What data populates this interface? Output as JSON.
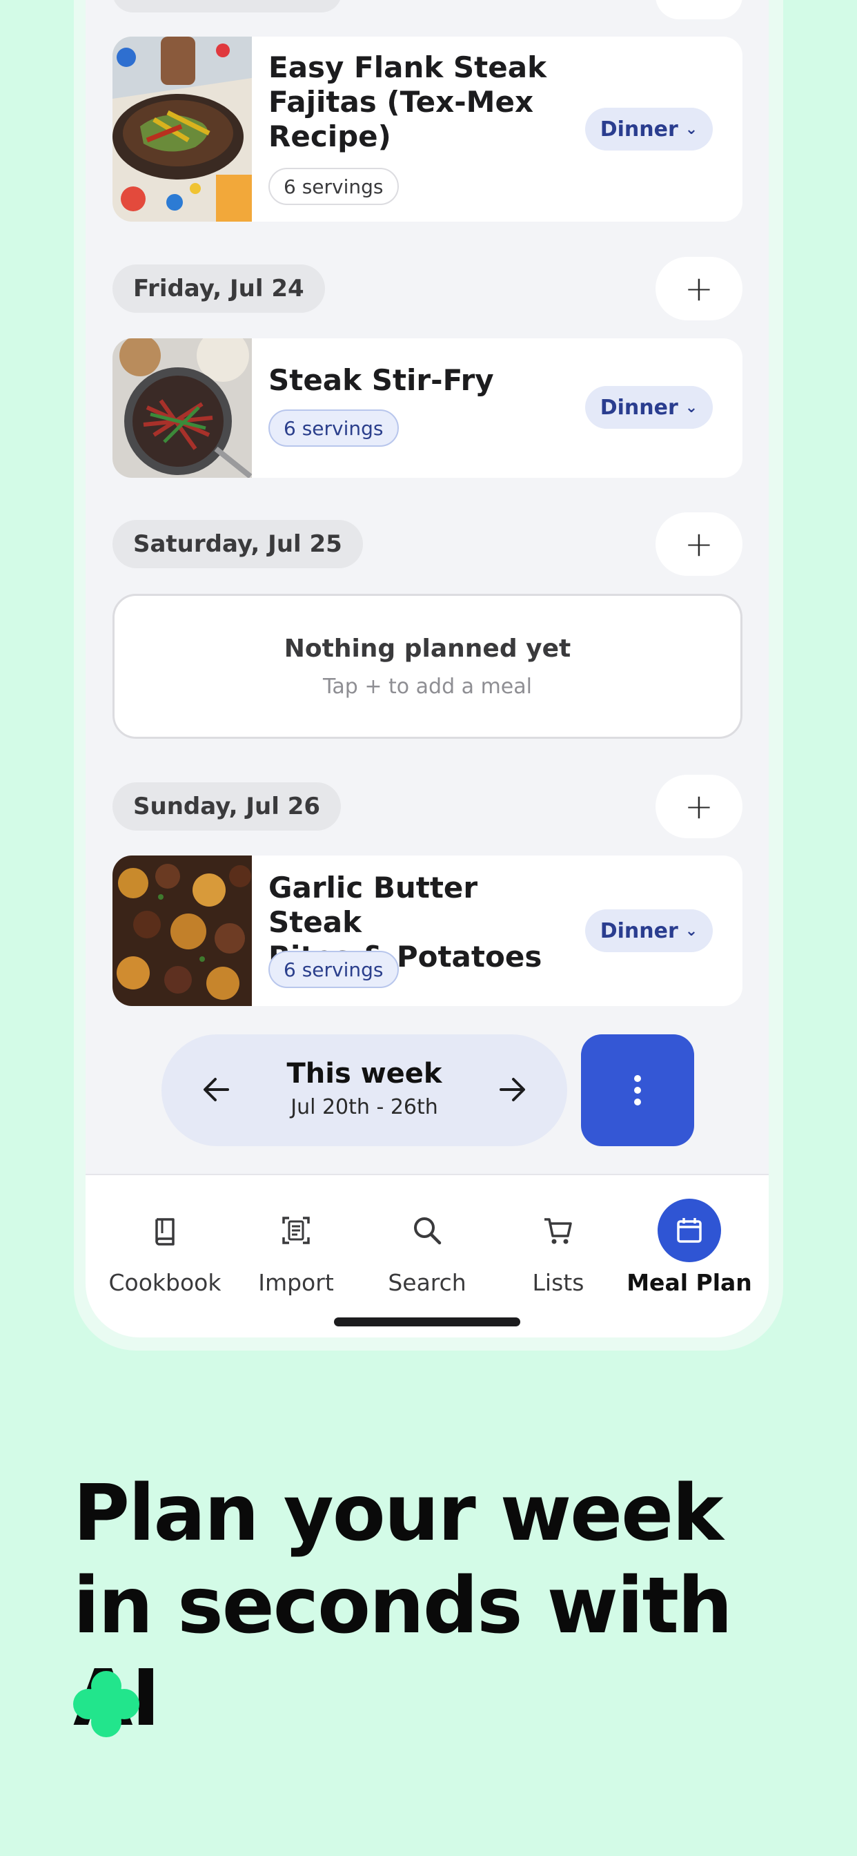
{
  "days": [
    {
      "meal": {
        "title": "Easy Flank Steak Fajitas (Tex-Mex Recipe)",
        "title_lines": [
          "Easy Flank Steak",
          "Fajitas (Tex-Mex",
          "Recipe)"
        ],
        "servings": "6 servings",
        "type": "Dinner"
      }
    },
    {
      "label": "Friday, Jul 24",
      "meal": {
        "title": "Steak Stir-Fry",
        "servings": "6 servings",
        "type": "Dinner"
      }
    },
    {
      "label": "Saturday, Jul 25",
      "empty": {
        "title": "Nothing planned yet",
        "subtitle": "Tap + to add a meal"
      }
    },
    {
      "label": "Sunday, Jul 26",
      "meal": {
        "title": "Garlic Butter Steak Bites & Potatoes",
        "title_lines": [
          "Garlic Butter Steak",
          "Bites & Potatoes"
        ],
        "servings": "6 servings",
        "type": "Dinner"
      }
    }
  ],
  "add_symbol": "+",
  "week": {
    "title": "This week",
    "range": "Jul 20th - 26th"
  },
  "nav": {
    "items": [
      {
        "label": "Cookbook",
        "icon": "book-icon"
      },
      {
        "label": "Import",
        "icon": "document-scan-icon"
      },
      {
        "label": "Search",
        "icon": "search-icon"
      },
      {
        "label": "Lists",
        "icon": "cart-icon"
      },
      {
        "label": "Meal Plan",
        "icon": "calendar-icon",
        "active": true
      }
    ]
  },
  "headline": "Plan your week in seconds with AI",
  "colors": {
    "background": "#d3fbe7",
    "accent": "#3457d5",
    "sparkle": "#22e58c"
  }
}
